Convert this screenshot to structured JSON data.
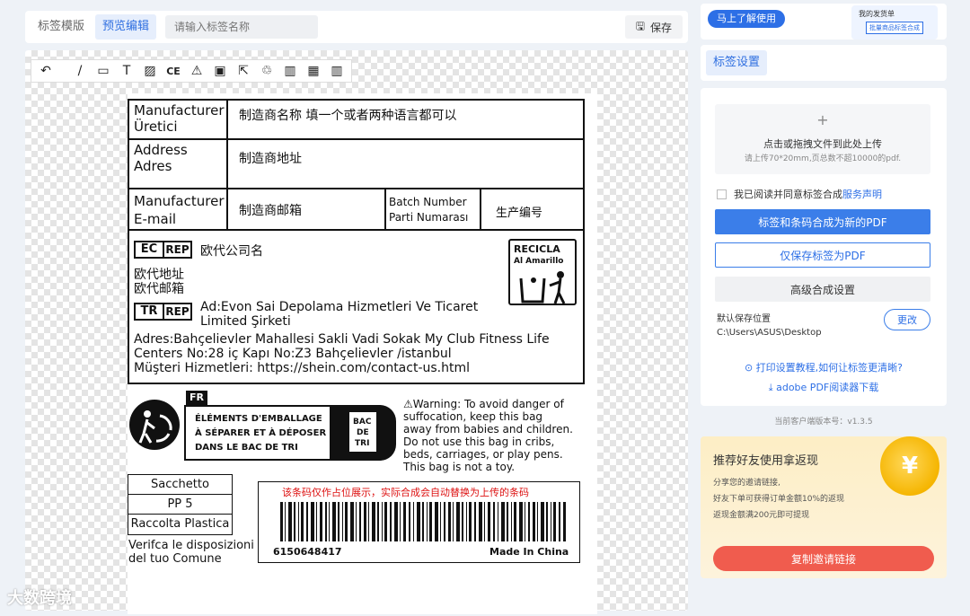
{
  "toolbar": {
    "tab_template": "标签模版",
    "tab_preview": "预览编辑",
    "name_placeholder": "请输入标签名称",
    "save_label": "保存"
  },
  "tools": [
    "undo-icon",
    "line-icon",
    "rect-icon",
    "text-icon",
    "image-icon",
    "ce-icon",
    "warning-icon",
    "save-icon",
    "export-icon",
    "recycle-icon",
    "barcode-icon",
    "qrcode-icon",
    "barcode2-icon"
  ],
  "label": {
    "row1_left1": "Manufacturer",
    "row1_left2": "Üretici",
    "row1_right": "制造商名称 填一个或者两种语言都可以",
    "row2_left1": "Address",
    "row2_left2": "Adres",
    "row2_right": "制造商地址",
    "row3_left1": "Manufacturer",
    "row3_left2": "E-mail",
    "row3_mid": "制造商邮箱",
    "row3_batch1": "Batch Number",
    "row3_batch2": "Parti Numarası",
    "row3_batch_value": "生产编号",
    "ec_rep": {
      "ec": "EC",
      "rep": "REP",
      "name": "欧代公司名",
      "addr": "欧代地址",
      "email": "欧代邮箱"
    },
    "recicla": {
      "t1": "RECICLA",
      "t2": "Al Amarillo"
    },
    "tr_rep": {
      "tr": "TR",
      "rep": "REP",
      "ad1": "Ad:Evon Sai Depolama Hizmetleri Ve Ticaret",
      "ad2": "Limited Şirketi"
    },
    "adres1": "Adres:Bahçelievler Mahallesi Sakli Vadi Sokak My Club Fitness Life",
    "adres2": "Centers No:28 iç Kapı No:Z3 Bahçelievler /istanbul",
    "adres3": "Müşteri Hizmetleri: https://shein.com/contact-us.html",
    "fr": {
      "code": "FR",
      "l1": "ÉLÉMENTS D'EMBALLAGE",
      "l2": "À SÉPARER ET À DÉPOSER",
      "l3": "DANS LE BAC DE TRI",
      "bac1": "BAC",
      "bac2": "DE",
      "bac3": "TRI"
    },
    "warning": [
      "⚠Warning: To avoid danger of",
      "suffocation, keep this bag",
      "away from babies and children.",
      "Do not use this bag in cribs,",
      "beds, carriages, or play pens.",
      "This bag is not a toy."
    ],
    "plastic": [
      "Sacchetto",
      "PP 5",
      "Raccolta Plastica"
    ],
    "verifica1": "Verifca le disposizioni",
    "verifica2": "del tuo Comune",
    "barcode_note": "该条码仅作占位展示，实际合成会自动替换为上传的条码",
    "barcode_number": "6150648417",
    "made_in": "Made In China"
  },
  "right": {
    "learn_btn": "马上了解使用",
    "promo_title": "我的发货单",
    "promo_btn": "批量商品标签合成",
    "settings_title": "标签设置",
    "upload_plus": "+",
    "upload_main": "点击或拖拽文件到此处上传",
    "upload_sub": "请上传70*20mm,页总数不超10000的pdf.",
    "agree_text": "我已阅读并同意标签合成",
    "agree_link": "服务声明",
    "btn_merge": "标签和条码合成为新的PDF",
    "btn_save_pdf": "仅保存标签为PDF",
    "btn_advanced": "高级合成设置",
    "save_loc_label": "默认保存位置",
    "save_loc_path": "C:\\Users\\ASUS\\Desktop",
    "change_btn": "更改",
    "help1": "⊙ 打印设置教程,如何让标签更清晰?",
    "help2": "⤓ adobe PDF阅读器下载",
    "version": "当前客户端版本号：v1.3.5",
    "invite_title": "推荐好友使用拿返现",
    "invite_d1": "分享您的邀请链接,",
    "invite_d2": "好友下单可获得订单金额10%的返现",
    "invite_d3": "返现金额满200元即可提现",
    "coin": "¥",
    "invite_btn": "复制邀请链接"
  },
  "watermark": "大数跨境"
}
